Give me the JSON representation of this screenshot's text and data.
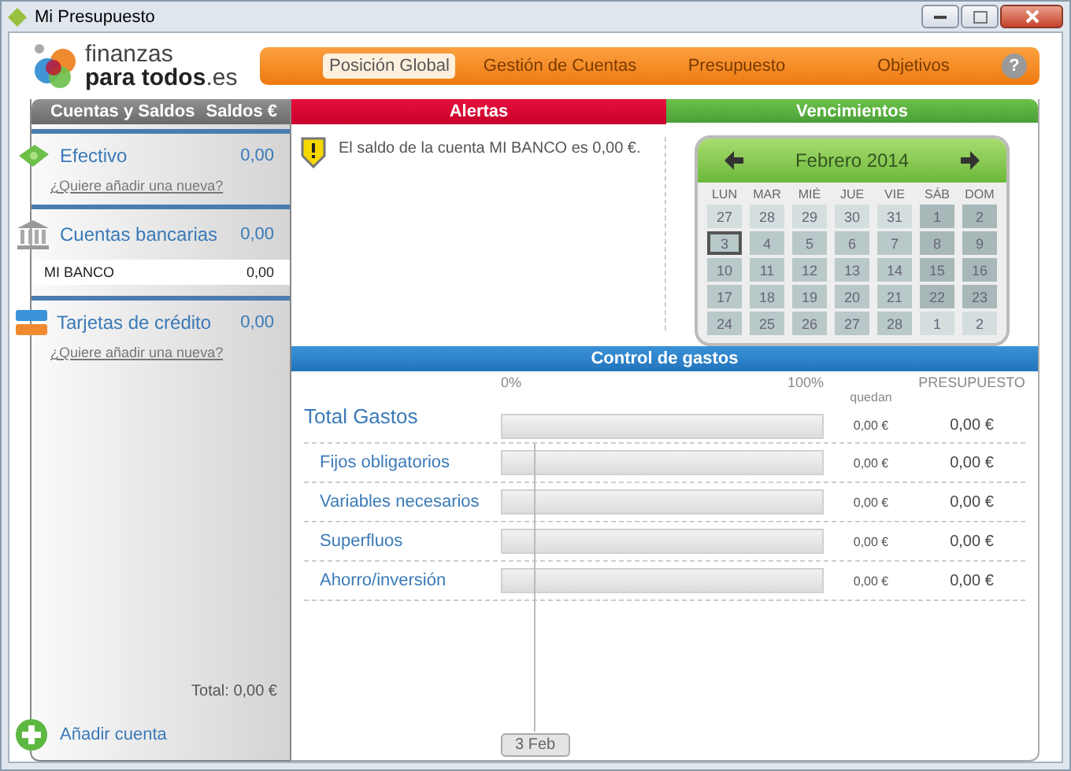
{
  "window": {
    "title": "Mi Presupuesto"
  },
  "logo": {
    "line_1": "finanzas",
    "line_2": "para todos",
    "line_2_suffix": ".es"
  },
  "nav": {
    "tabs": [
      {
        "label": "Posición Global",
        "selected": true
      },
      {
        "label": "Gestión de Cuentas",
        "selected": false
      },
      {
        "label": "Presupuesto",
        "selected": false
      },
      {
        "label": "Objetivos",
        "selected": false
      }
    ],
    "help": "?"
  },
  "sidebar": {
    "header": {
      "title": "Cuentas y Saldos",
      "balance": "Saldos €"
    },
    "groups": [
      {
        "kind": "cash",
        "name": "Efectivo",
        "amount": "0,00",
        "add_link": "¿Quiere añadir una nueva?"
      },
      {
        "kind": "bank",
        "name": "Cuentas bancarias",
        "amount": "0,00",
        "accounts": [
          {
            "name": "MI BANCO",
            "amount": "0,00"
          }
        ]
      },
      {
        "kind": "card",
        "name": "Tarjetas de crédito",
        "amount": "0,00",
        "add_link": "¿Quiere añadir una nueva?"
      }
    ],
    "total": "Total: 0,00 €",
    "add_account": "Añadir cuenta"
  },
  "alerts": {
    "title": "Alertas",
    "items": [
      "El saldo de la cuenta MI BANCO es 0,00 €."
    ]
  },
  "due_dates": {
    "title": "Vencimientos",
    "calendar": {
      "month": "Febrero 2014",
      "weekdays": [
        "LUN",
        "MAR",
        "MIÉ",
        "JUE",
        "VIE",
        "SÁB",
        "DOM"
      ],
      "days": [
        {
          "day": "27",
          "muted": true,
          "selected": false
        },
        {
          "day": "28",
          "muted": true,
          "selected": false
        },
        {
          "day": "29",
          "muted": true,
          "selected": false
        },
        {
          "day": "30",
          "muted": true,
          "selected": false
        },
        {
          "day": "31",
          "muted": true,
          "selected": false
        },
        {
          "day": "1",
          "muted": false,
          "selected": false
        },
        {
          "day": "2",
          "muted": false,
          "selected": false
        },
        {
          "day": "3",
          "muted": false,
          "selected": true
        },
        {
          "day": "4",
          "muted": false,
          "selected": false
        },
        {
          "day": "5",
          "muted": false,
          "selected": false
        },
        {
          "day": "6",
          "muted": false,
          "selected": false
        },
        {
          "day": "7",
          "muted": false,
          "selected": false
        },
        {
          "day": "8",
          "muted": false,
          "selected": false
        },
        {
          "day": "9",
          "muted": false,
          "selected": false
        },
        {
          "day": "10",
          "muted": false,
          "selected": false
        },
        {
          "day": "11",
          "muted": false,
          "selected": false
        },
        {
          "day": "12",
          "muted": false,
          "selected": false
        },
        {
          "day": "13",
          "muted": false,
          "selected": false
        },
        {
          "day": "14",
          "muted": false,
          "selected": false
        },
        {
          "day": "15",
          "muted": false,
          "selected": false
        },
        {
          "day": "16",
          "muted": false,
          "selected": false
        },
        {
          "day": "17",
          "muted": false,
          "selected": false
        },
        {
          "day": "18",
          "muted": false,
          "selected": false
        },
        {
          "day": "19",
          "muted": false,
          "selected": false
        },
        {
          "day": "20",
          "muted": false,
          "selected": false
        },
        {
          "day": "21",
          "muted": false,
          "selected": false
        },
        {
          "day": "22",
          "muted": false,
          "selected": false
        },
        {
          "day": "23",
          "muted": false,
          "selected": false
        },
        {
          "day": "24",
          "muted": false,
          "selected": false
        },
        {
          "day": "25",
          "muted": false,
          "selected": false
        },
        {
          "day": "26",
          "muted": false,
          "selected": false
        },
        {
          "day": "27",
          "muted": false,
          "selected": false
        },
        {
          "day": "28",
          "muted": false,
          "selected": false
        },
        {
          "day": "1",
          "muted": true,
          "selected": false
        },
        {
          "day": "2",
          "muted": true,
          "selected": false
        }
      ]
    }
  },
  "spending": {
    "title": "Control de gastos",
    "scale_start": "0%",
    "scale_end": "100%",
    "remaining_header": "quedan",
    "budget_header": "PRESUPUESTO",
    "rows": [
      {
        "kind": "total",
        "label": "Total Gastos",
        "level": 0,
        "remaining": "0,00 €",
        "budget": "0,00 €"
      },
      {
        "kind": "category",
        "label": "Fijos obligatorios",
        "level": 0,
        "remaining": "0,00 €",
        "budget": "0,00 €"
      },
      {
        "kind": "category",
        "label": "Variables necesarios",
        "level": 0,
        "remaining": "0,00 €",
        "budget": "0,00 €"
      },
      {
        "kind": "category",
        "label": "Superfluos",
        "level": 0,
        "remaining": "0,00 €",
        "budget": "0,00 €"
      },
      {
        "kind": "category",
        "label": "Ahorro/inversión",
        "level": 0,
        "remaining": "0,00 €",
        "budget": "0,00 €"
      }
    ],
    "today_marker": "3 Feb"
  }
}
